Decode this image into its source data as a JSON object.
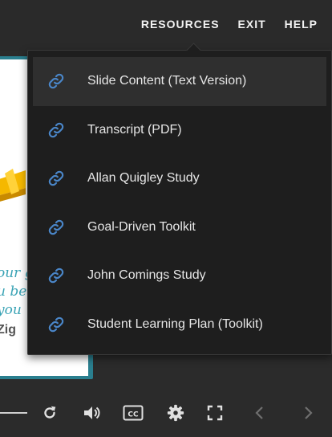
{
  "header": {
    "nav": [
      {
        "label": "RESOURCES"
      },
      {
        "label": "EXIT"
      },
      {
        "label": "HELP"
      }
    ]
  },
  "slide": {
    "quote_lines": [
      "our g",
      "u bec",
      "you"
    ],
    "author": "Zig"
  },
  "resources_menu": {
    "items": [
      {
        "label": "Slide Content (Text Version)",
        "icon": "link-icon"
      },
      {
        "label": "Transcript (PDF)",
        "icon": "link-icon"
      },
      {
        "label": "Allan Quigley Study",
        "icon": "link-icon"
      },
      {
        "label": "Goal-Driven Toolkit",
        "icon": "link-icon"
      },
      {
        "label": "John Comings Study",
        "icon": "link-icon"
      },
      {
        "label": "Student Learning Plan (Toolkit)",
        "icon": "link-icon"
      }
    ]
  },
  "colors": {
    "background": "#2b2b2b",
    "menu_background": "#1e1e1e",
    "menu_highlight": "#2f2f2f",
    "link_icon": "#4a86c8",
    "text": "#e6e6e6"
  }
}
